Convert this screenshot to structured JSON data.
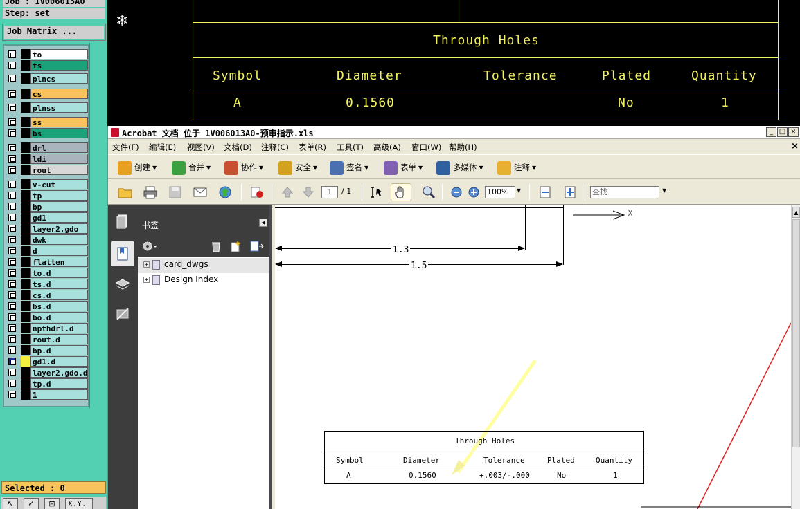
{
  "genesis": {
    "job_label": "Job : 1V006013A0",
    "step_label": "Step: set",
    "job_matrix_button": "Job Matrix ...",
    "layers": [
      {
        "name": "to",
        "color": "#ffffff"
      },
      {
        "name": "ts",
        "color": "#1aa37a"
      },
      {
        "name": "plncs",
        "color": "#a8e0de"
      },
      {
        "name": "cs",
        "color": "#f8c35a"
      },
      {
        "name": "plnss",
        "color": "#a8e0de"
      },
      {
        "name": "ss",
        "color": "#f8c35a"
      },
      {
        "name": "bs",
        "color": "#1aa37a"
      },
      {
        "name": "drl",
        "color": "#a9b4bc"
      },
      {
        "name": "ldi",
        "color": "#a9b4bc"
      },
      {
        "name": "rout",
        "color": "#d8d8d8"
      },
      {
        "name": "v-cut",
        "color": "#a8e0de"
      },
      {
        "name": "tp",
        "color": "#a8e0de"
      },
      {
        "name": "bp",
        "color": "#a8e0de"
      },
      {
        "name": "gd1",
        "color": "#a8e0de"
      },
      {
        "name": "layer2.gdo",
        "color": "#a8e0de"
      },
      {
        "name": "dwk",
        "color": "#a8e0de"
      },
      {
        "name": "d",
        "color": "#a8e0de"
      },
      {
        "name": "flatten",
        "color": "#a8e0de"
      },
      {
        "name": "to.d",
        "color": "#a8e0de"
      },
      {
        "name": "ts.d",
        "color": "#a8e0de"
      },
      {
        "name": "cs.d",
        "color": "#a8e0de"
      },
      {
        "name": "bs.d",
        "color": "#a8e0de"
      },
      {
        "name": "bo.d",
        "color": "#a8e0de"
      },
      {
        "name": "npthdrl.d",
        "color": "#a8e0de"
      },
      {
        "name": "rout.d",
        "color": "#a8e0de"
      },
      {
        "name": "bp.d",
        "color": "#a8e0de"
      },
      {
        "name": "gd1.d",
        "color": "#a8e0de"
      },
      {
        "name": "layer2.gdo.d",
        "color": "#a8e0de"
      },
      {
        "name": "tp.d",
        "color": "#a8e0de"
      },
      {
        "name": "1",
        "color": "#a8e0de"
      }
    ],
    "selected_status": "Selected : 0",
    "bottom_tools": [
      "↖",
      "✓",
      "⊡",
      "X.Y."
    ]
  },
  "cad_table": {
    "title": "Through Holes",
    "headers": [
      "Symbol",
      "Diameter",
      "Tolerance",
      "Plated",
      "Quantity"
    ],
    "row": [
      "A",
      "0.1560",
      "",
      "No",
      "1"
    ]
  },
  "acrobat": {
    "title": "Acrobat 文档 位于 1V006013A0-预审指示.xls",
    "window_controls": [
      "_",
      "□",
      "×"
    ],
    "menus": [
      "文件(F)",
      "编辑(E)",
      "视图(V)",
      "文档(D)",
      "注释(C)",
      "表单(R)",
      "工具(T)",
      "高级(A)",
      "窗口(W)",
      "帮助(H)"
    ],
    "menu_close": "×",
    "toolbar": [
      {
        "label": "创建",
        "icon": "create-icon",
        "color": "#e8a020"
      },
      {
        "label": "合并",
        "icon": "combine-icon",
        "color": "#3aa040"
      },
      {
        "label": "协作",
        "icon": "collaborate-icon",
        "color": "#c85030"
      },
      {
        "label": "安全",
        "icon": "lock-icon",
        "color": "#d4a020"
      },
      {
        "label": "签名",
        "icon": "pen-icon",
        "color": "#4a70b0"
      },
      {
        "label": "表单",
        "icon": "form-icon",
        "color": "#8060b0"
      },
      {
        "label": "多媒体",
        "icon": "multimedia-icon",
        "color": "#3060a0"
      },
      {
        "label": "注释",
        "icon": "comment-icon",
        "color": "#e8b030"
      }
    ],
    "page_current": "1",
    "page_total": "/ 1",
    "zoom": "100%",
    "find_placeholder": "查找",
    "bookmarks_title": "书签",
    "bookmarks": [
      "card_dwgs",
      "Design Index"
    ],
    "doc": {
      "dim_1": "1.3",
      "dim_2": "1.5",
      "axis_x": "X",
      "table_title": "Through Holes",
      "headers": [
        "Symbol",
        "Diameter",
        "Tolerance",
        "Plated",
        "Quantity"
      ],
      "row": [
        "A",
        "0.1560",
        "+.003/-.000",
        "No",
        "1"
      ]
    }
  }
}
